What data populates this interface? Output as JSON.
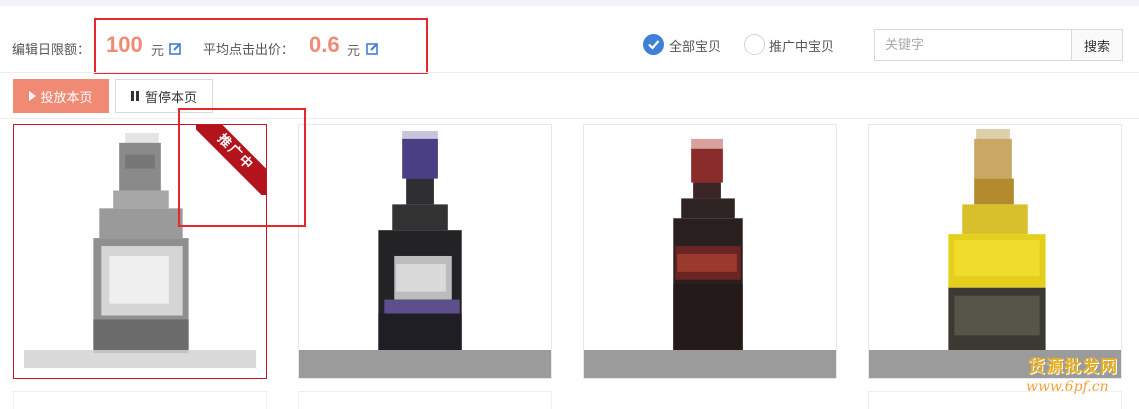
{
  "budget": {
    "label": "编辑日限额：",
    "value": "100",
    "unit": "元"
  },
  "avg_bid": {
    "label": "平均点击出价：",
    "value": "0.6",
    "unit": "元"
  },
  "filters": [
    {
      "label": "全部宝贝",
      "selected": true
    },
    {
      "label": "推广中宝贝",
      "selected": false
    }
  ],
  "search": {
    "placeholder": "关键字",
    "value": "",
    "button_label": "搜索"
  },
  "actions": {
    "launch_label": "投放本页",
    "pause_label": "暂停本页"
  },
  "products": [
    {
      "badge": "推广中",
      "selected": true,
      "bottle": "gray"
    },
    {
      "badge": "",
      "selected": false,
      "bottle": "purple"
    },
    {
      "badge": "",
      "selected": false,
      "bottle": "red"
    },
    {
      "badge": "",
      "selected": false,
      "bottle": "yellow"
    }
  ],
  "watermark": {
    "title": "货源批发网",
    "url": "www.6pf.cn"
  },
  "colors": {
    "accent": "#f08a75",
    "radio_on": "#3f7fd6",
    "badge_red": "#b3131a",
    "annotation_red": "#e8262b"
  }
}
